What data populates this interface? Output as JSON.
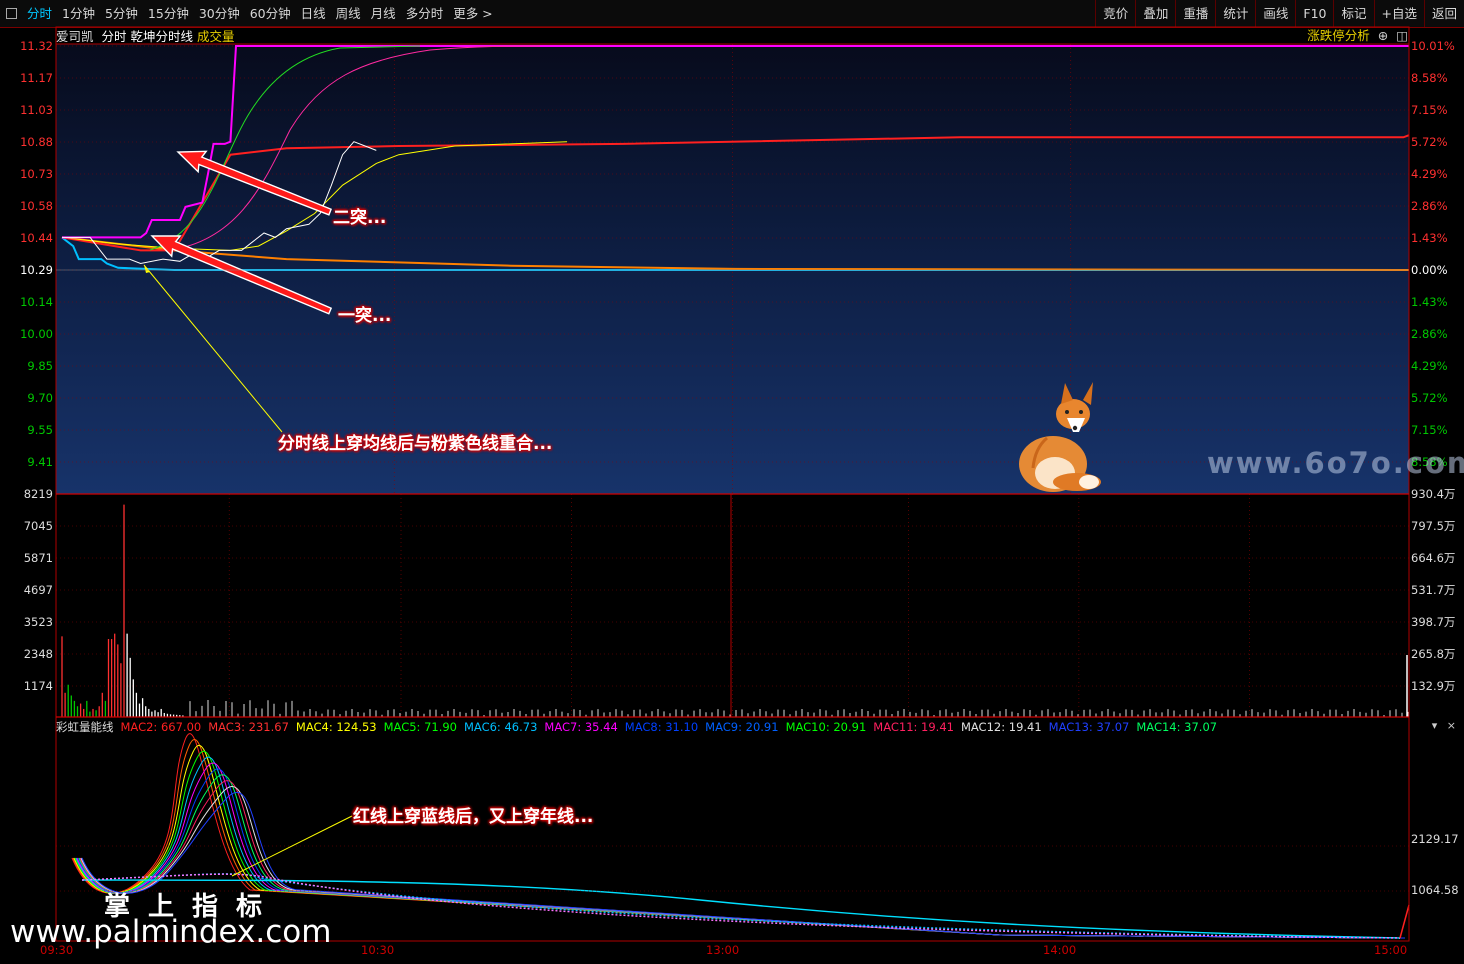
{
  "toolbar": {
    "periods": [
      "分时",
      "1分钟",
      "5分钟",
      "15分钟",
      "30分钟",
      "60分钟",
      "日线",
      "周线",
      "月线",
      "多分时",
      "更多 >"
    ],
    "active_period": "分时",
    "tools": [
      "竞价",
      "叠加",
      "重播",
      "统计",
      "画线",
      "F10",
      "标记",
      "+自选",
      "返回"
    ]
  },
  "chart_header": {
    "stock_name": "爱司凯",
    "mode": "分时",
    "indicator": "乾坤分时线",
    "volume_label": "成交量",
    "limit_analysis": "涨跌停分析"
  },
  "colors": {
    "up": "#ff3030",
    "down": "#00c800",
    "flat": "#ffffff",
    "grid": "#8b0000",
    "price_line": "#ffffff",
    "avg_line": "#ffff00",
    "magenta_line": "#ff00ff",
    "red_line": "#ff2020",
    "orange_line": "#ff8000",
    "cyan_line": "#00bfff",
    "bg_top": "#0a0f22",
    "bg_bottom": "#17336a"
  },
  "price_axis": {
    "left_labels": [
      "11.32",
      "11.17",
      "11.03",
      "10.88",
      "10.73",
      "10.58",
      "10.44",
      "10.29",
      "10.14",
      "10.00",
      "9.85",
      "9.70",
      "9.55",
      "9.41"
    ],
    "right_labels": [
      "10.01%",
      "8.58%",
      "7.15%",
      "5.72%",
      "4.29%",
      "2.86%",
      "1.43%",
      "0.00%",
      "1.43%",
      "2.86%",
      "4.29%",
      "5.72%",
      "7.15%",
      "8.58%"
    ]
  },
  "volume_axis": {
    "left_labels": [
      "8219",
      "7045",
      "5871",
      "4697",
      "3523",
      "2348",
      "1174"
    ],
    "right_labels": [
      "930.4万",
      "797.5万",
      "664.6万",
      "531.7万",
      "398.7万",
      "265.8万",
      "132.9万"
    ]
  },
  "indicator_panel": {
    "name": "彩虹量能线",
    "legend": [
      {
        "label": "MAC2: 667.00",
        "color": "#ff2020"
      },
      {
        "label": "MAC3: 231.67",
        "color": "#ff3030"
      },
      {
        "label": "MAC4: 124.53",
        "color": "#ffff00"
      },
      {
        "label": "MAC5: 71.90",
        "color": "#00ff00"
      },
      {
        "label": "MAC6: 46.73",
        "color": "#00bfff"
      },
      {
        "label": "MAC7: 35.44",
        "color": "#ff00ff"
      },
      {
        "label": "MAC8: 31.10",
        "color": "#0040ff"
      },
      {
        "label": "MAC9: 20.91",
        "color": "#0060ff"
      },
      {
        "label": "MAC10: 20.91",
        "color": "#00ff00"
      },
      {
        "label": "MAC11: 19.41",
        "color": "#ff2060"
      },
      {
        "label": "MAC12: 19.41",
        "color": "#e0e0e0"
      },
      {
        "label": "MAC13: 37.07",
        "color": "#2040ff"
      },
      {
        "label": "MAC14: 37.07",
        "color": "#00ff60"
      }
    ],
    "right_labels": [
      "2129.17",
      "1064.58"
    ]
  },
  "time_axis": [
    "09:30",
    "10:30",
    "13:00",
    "14:00",
    "15:00"
  ],
  "annotations": {
    "second_break": "二突...",
    "first_break": "一突...",
    "crossover": "分时线上穿均线后与粉紫色线重合...",
    "red_cross": "红线上穿蓝线后，又上穿年线..."
  },
  "watermarks": {
    "site_6070": "www.6o7o.com",
    "cn_title": "掌上指标",
    "palm_url": "www.palmindex.com"
  },
  "chart_data": {
    "type": "line",
    "prev_close": 10.29,
    "ylim": [
      9.26,
      11.32
    ],
    "minutes": 240,
    "series": [
      {
        "key": "price",
        "values": [
          [
            0,
            10.44
          ],
          [
            5,
            10.44
          ],
          [
            8,
            10.34
          ],
          [
            12,
            10.34
          ],
          [
            14,
            10.32
          ],
          [
            18,
            10.34
          ],
          [
            21,
            10.33
          ],
          [
            23,
            10.36
          ],
          [
            26,
            10.35
          ],
          [
            28,
            10.38
          ],
          [
            32,
            10.38
          ],
          [
            34,
            10.42
          ],
          [
            36,
            10.46
          ],
          [
            38,
            10.44
          ],
          [
            40,
            10.48
          ],
          [
            44,
            10.5
          ],
          [
            46,
            10.55
          ],
          [
            48,
            10.68
          ],
          [
            50,
            10.82
          ],
          [
            52,
            10.88
          ],
          [
            54,
            10.86
          ],
          [
            56,
            10.84
          ]
        ]
      },
      {
        "key": "avg",
        "values": [
          [
            0,
            10.44
          ],
          [
            10,
            10.41
          ],
          [
            20,
            10.39
          ],
          [
            30,
            10.38
          ],
          [
            35,
            10.4
          ],
          [
            40,
            10.47
          ],
          [
            45,
            10.55
          ],
          [
            50,
            10.68
          ],
          [
            56,
            10.78
          ],
          [
            60,
            10.82
          ],
          [
            70,
            10.86
          ],
          [
            90,
            10.88
          ]
        ]
      },
      {
        "key": "magenta",
        "values": [
          [
            0,
            10.44
          ],
          [
            14,
            10.44
          ],
          [
            15,
            10.46
          ],
          [
            16,
            10.52
          ],
          [
            21,
            10.52
          ],
          [
            22,
            10.58
          ],
          [
            25,
            10.6
          ],
          [
            26,
            10.73
          ],
          [
            27,
            10.87
          ],
          [
            29,
            10.87
          ],
          [
            30,
            10.88
          ],
          [
            31,
            11.32
          ],
          [
            64,
            11.32
          ],
          [
            85,
            11.32
          ],
          [
            240,
            11.32
          ]
        ]
      },
      {
        "key": "red",
        "values": [
          [
            0,
            10.44
          ],
          [
            14,
            10.38
          ],
          [
            20,
            10.38
          ],
          [
            30,
            10.82
          ],
          [
            40,
            10.85
          ],
          [
            60,
            10.86
          ],
          [
            100,
            10.87
          ],
          [
            160,
            10.9
          ],
          [
            239,
            10.9
          ],
          [
            240,
            10.91
          ]
        ]
      },
      {
        "key": "orange",
        "values": [
          [
            0,
            10.44
          ],
          [
            20,
            10.38
          ],
          [
            40,
            10.34
          ],
          [
            80,
            10.31
          ],
          [
            120,
            10.295
          ],
          [
            240,
            10.29
          ]
        ]
      },
      {
        "key": "cyan",
        "values": [
          [
            0,
            10.44
          ],
          [
            2,
            10.4
          ],
          [
            3,
            10.34
          ],
          [
            7,
            10.34
          ],
          [
            8,
            10.32
          ],
          [
            10,
            10.3
          ],
          [
            20,
            10.29
          ],
          [
            100,
            10.29
          ],
          [
            240,
            10.29
          ]
        ]
      }
    ]
  }
}
